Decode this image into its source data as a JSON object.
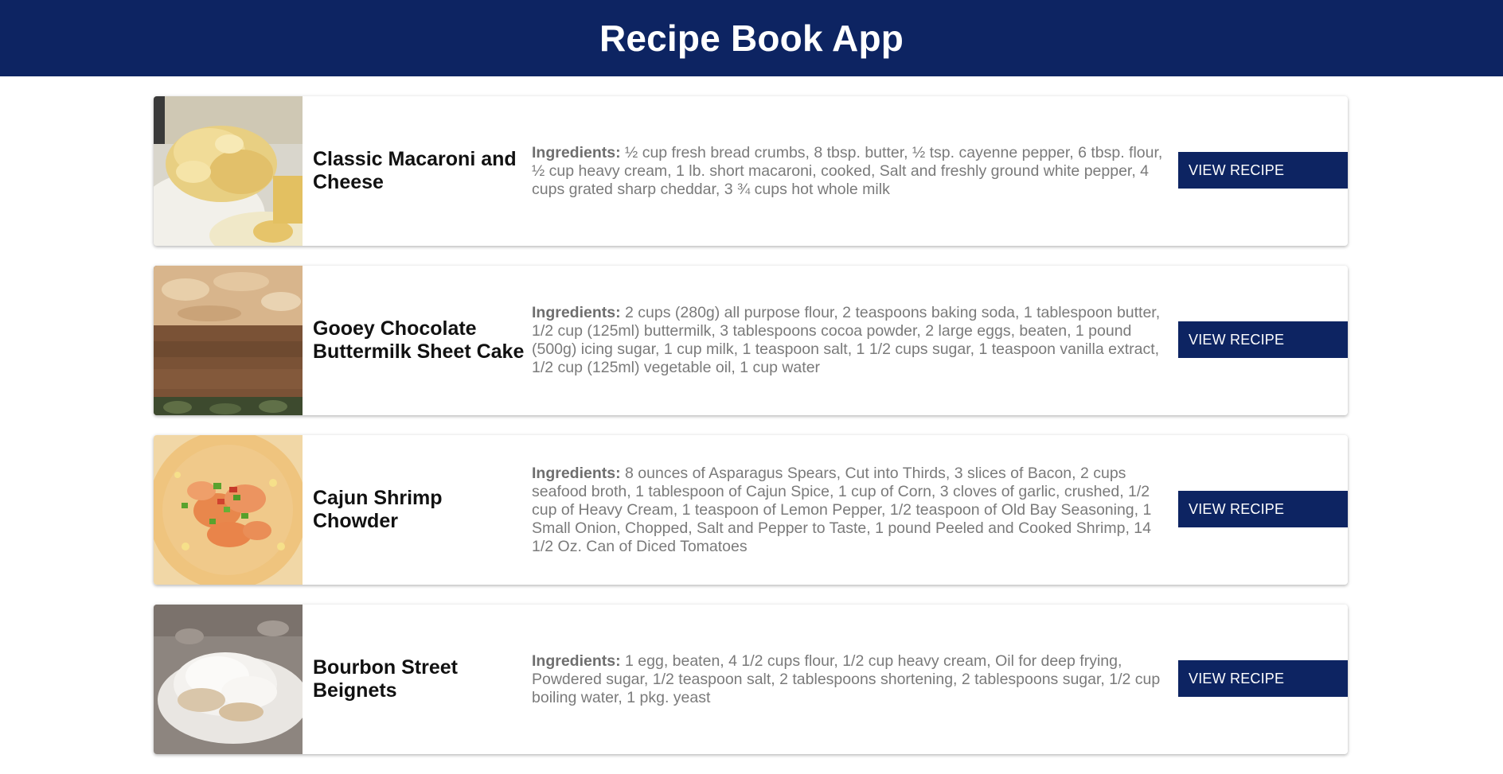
{
  "header": {
    "title": "Recipe Book App",
    "background_color": "#0d2462"
  },
  "recipes": [
    {
      "name": "Classic Macaroni and Cheese",
      "ingredients_label": "Ingredients:",
      "ingredients": "½ cup fresh bread crumbs, 8 tbsp. butter, ½ tsp. cayenne pepper, 6 tbsp. flour, ½ cup heavy cream, 1 lb. short macaroni, cooked, Salt and freshly ground white pepper, 4 cups grated sharp cheddar, 3 ¾ cups hot whole milk",
      "button_label": "VIEW RECIPE",
      "image": "macaroni-and-cheese-photo"
    },
    {
      "name": "Gooey Chocolate Buttermilk Sheet Cake",
      "ingredients_label": "Ingredients:",
      "ingredients": "2 cups (280g) all purpose flour, 2 teaspoons baking soda, 1 tablespoon butter, 1/2 cup (125ml) buttermilk, 3 tablespoons cocoa powder, 2 large eggs, beaten, 1 pound (500g) icing sugar, 1 cup milk, 1 teaspoon salt, 1 1/2 cups sugar, 1 teaspoon vanilla extract, 1/2 cup (125ml) vegetable oil, 1 cup water",
      "button_label": "VIEW RECIPE",
      "image": "chocolate-sheet-cake-photo"
    },
    {
      "name": "Cajun Shrimp Chowder",
      "ingredients_label": "Ingredients:",
      "ingredients": "8 ounces of Asparagus Spears, Cut into Thirds, 3 slices of Bacon, 2 cups seafood broth, 1 tablespoon of Cajun Spice, 1 cup of Corn, 3 cloves of garlic, crushed, 1/2 cup of Heavy Cream, 1 teaspoon of Lemon Pepper, 1/2 teaspoon of Old Bay Seasoning, 1 Small Onion, Chopped, Salt and Pepper to Taste, 1 pound Peeled and Cooked Shrimp, 14 1/2 Oz. Can of Diced Tomatoes",
      "button_label": "VIEW RECIPE",
      "image": "shrimp-chowder-photo"
    },
    {
      "name": "Bourbon Street Beignets",
      "ingredients_label": "Ingredients:",
      "ingredients": "1 egg, beaten, 4 1/2 cups flour, 1/2 cup heavy cream, Oil for deep frying, Powdered sugar, 1/2 teaspoon salt, 2 tablespoons shortening, 2 tablespoons sugar, 1/2 cup boiling water, 1 pkg. yeast",
      "button_label": "VIEW RECIPE",
      "image": "beignets-photo"
    }
  ]
}
